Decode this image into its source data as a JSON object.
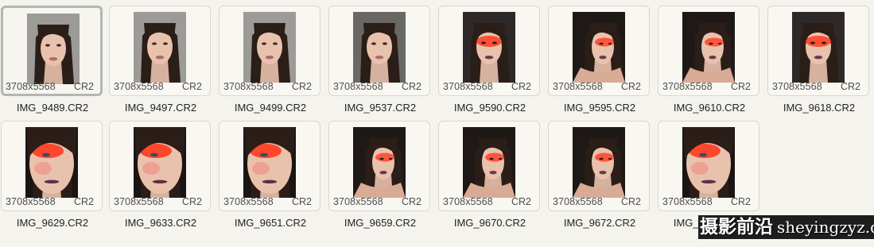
{
  "files": [
    {
      "name": "IMG_9489.CR2",
      "dims": "3708x5568",
      "type": "CR2",
      "selected": true,
      "variant": "natural"
    },
    {
      "name": "IMG_9497.CR2",
      "dims": "3708x5568",
      "type": "CR2",
      "selected": false,
      "variant": "natural"
    },
    {
      "name": "IMG_9499.CR2",
      "dims": "3708x5568",
      "type": "CR2",
      "selected": false,
      "variant": "natural"
    },
    {
      "name": "IMG_9537.CR2",
      "dims": "3708x5568",
      "type": "CR2",
      "selected": false,
      "variant": "natural"
    },
    {
      "name": "IMG_9590.CR2",
      "dims": "3708x5568",
      "type": "CR2",
      "selected": false,
      "variant": "red-makeup"
    },
    {
      "name": "IMG_9595.CR2",
      "dims": "3708x5568",
      "type": "CR2",
      "selected": false,
      "variant": "red-side"
    },
    {
      "name": "IMG_9610.CR2",
      "dims": "3708x5568",
      "type": "CR2",
      "selected": false,
      "variant": "red-side"
    },
    {
      "name": "IMG_9618.CR2",
      "dims": "3708x5568",
      "type": "CR2",
      "selected": false,
      "variant": "red-makeup"
    },
    {
      "name": "IMG_9629.CR2",
      "dims": "3708x5568",
      "type": "CR2",
      "selected": false,
      "variant": "closeup"
    },
    {
      "name": "IMG_9633.CR2",
      "dims": "3708x5568",
      "type": "CR2",
      "selected": false,
      "variant": "closeup"
    },
    {
      "name": "IMG_9651.CR2",
      "dims": "3708x5568",
      "type": "CR2",
      "selected": false,
      "variant": "closeup"
    },
    {
      "name": "IMG_9659.CR2",
      "dims": "3708x5568",
      "type": "CR2",
      "selected": false,
      "variant": "red-side"
    },
    {
      "name": "IMG_9670.CR2",
      "dims": "3708x5568",
      "type": "CR2",
      "selected": false,
      "variant": "red-side"
    },
    {
      "name": "IMG_9672.CR2",
      "dims": "3708x5568",
      "type": "CR2",
      "selected": false,
      "variant": "red-side"
    },
    {
      "name": "IMG_9679.CR2",
      "dims": "3708x5568",
      "type": "CR2",
      "selected": false,
      "variant": "closeup"
    }
  ],
  "watermark": {
    "cn": "摄影前沿",
    "en": "sheyingzyz.com"
  },
  "colors": {
    "background": "#f4f3ee",
    "card_border": "#d7d6cf",
    "selected_border": "#b5b5b2",
    "hair": "#2b1d17",
    "skin": "#e9c2ad",
    "red_makeup": "#ff3b1f"
  }
}
